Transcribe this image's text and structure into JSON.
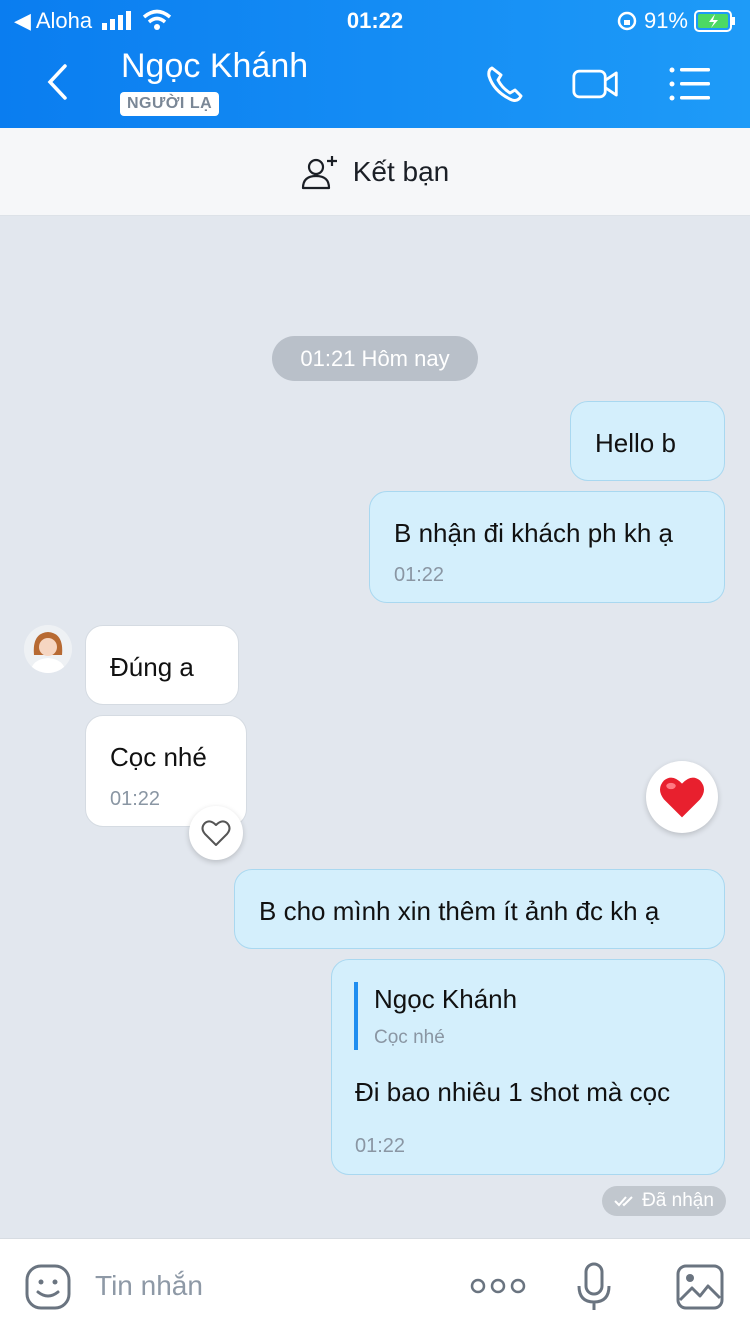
{
  "status_bar": {
    "carrier": "Aloha",
    "time": "01:22",
    "battery": "91%"
  },
  "header": {
    "contact_name": "Ngọc Khánh",
    "badge": "NGƯỜI LẠ"
  },
  "friend_bar": {
    "label": "Kết bạn"
  },
  "chat": {
    "timestamp_pill": "01:21 Hôm nay",
    "messages": [
      {
        "text": "Hello b"
      },
      {
        "text": "B nhận đi khách ph kh ạ",
        "time": "01:22"
      },
      {
        "text": "Đúng a"
      },
      {
        "text": "Cọc nhé",
        "time": "01:22"
      },
      {
        "text": "B cho mình xin thêm ít ảnh đc kh ạ"
      },
      {
        "reply_to_name": "Ngọc Khánh",
        "reply_to_text": "Cọc nhé",
        "text": "Đi bao nhiêu 1 shot mà cọc",
        "time": "01:22"
      }
    ],
    "delivered_label": "Đã nhận"
  },
  "input": {
    "placeholder": "Tin nhắn"
  },
  "colors": {
    "header": "#0a7df0",
    "outgoing_bubble": "#d4effc",
    "heart": "#e8202e"
  }
}
